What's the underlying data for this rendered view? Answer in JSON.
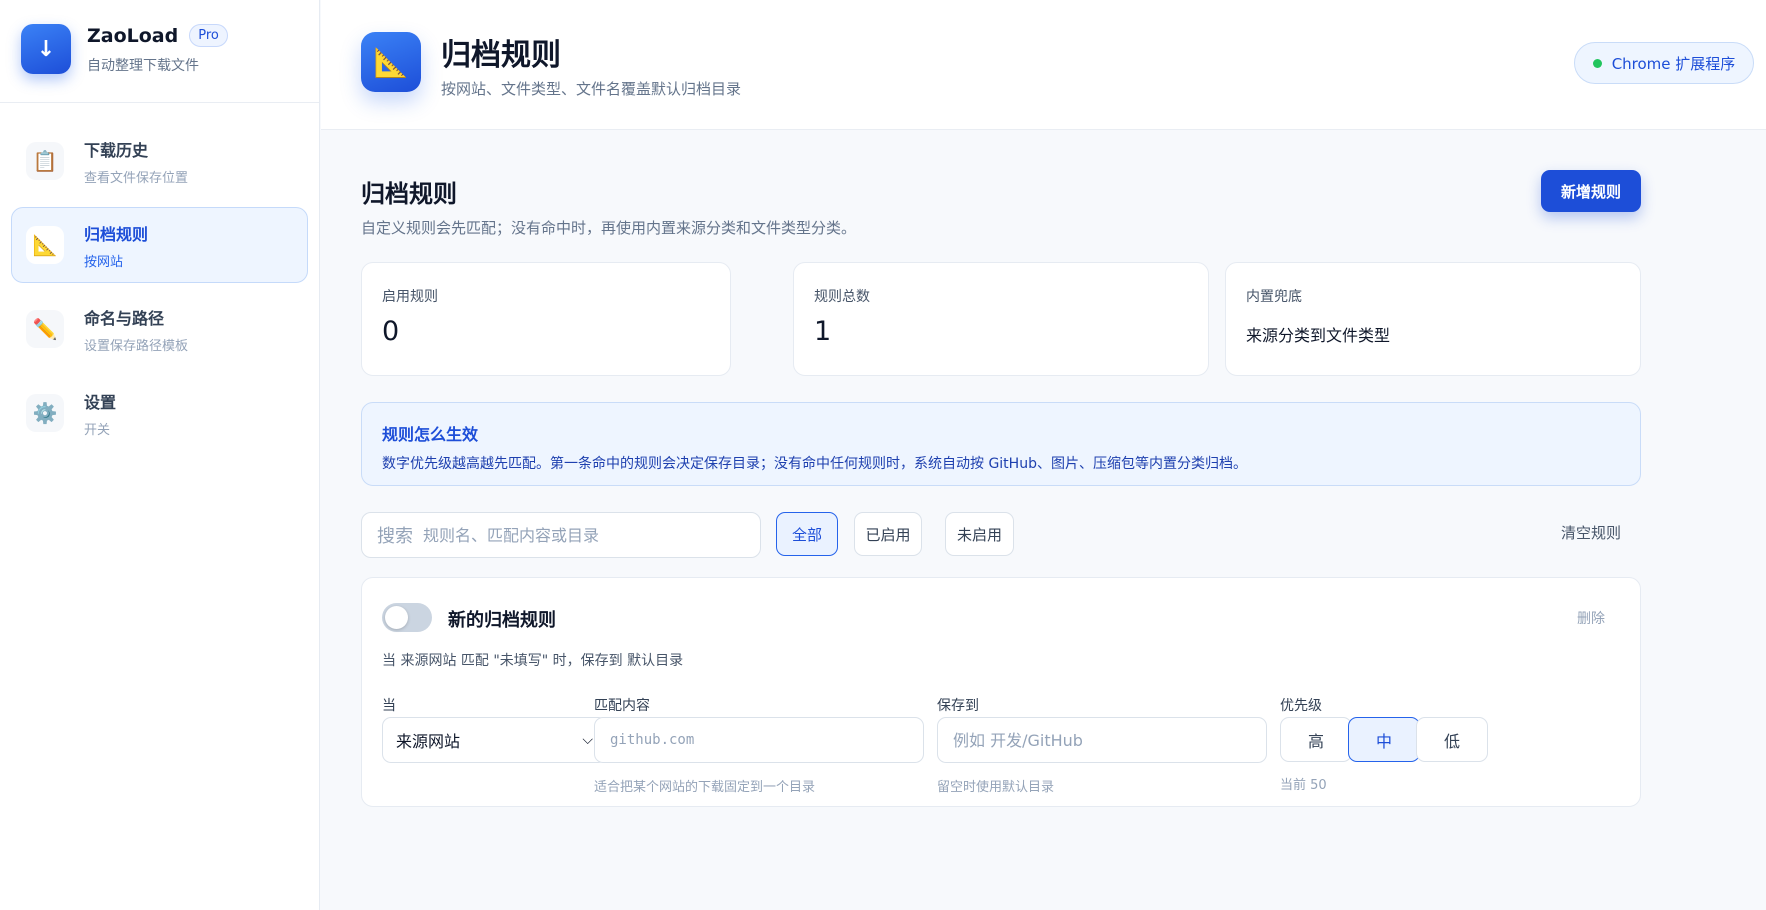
{
  "brand": {
    "logo_glyph": "↓",
    "name": "ZaoLoad",
    "badge": "Pro",
    "tagline": "自动整理下载文件"
  },
  "sidebar": {
    "items": [
      {
        "icon": "clipboard-icon",
        "glyph": "📋",
        "title": "下载历史",
        "subtitle": "查看文件保存位置",
        "active": false
      },
      {
        "icon": "triangle-ruler-icon",
        "glyph": "📐",
        "title": "归档规则",
        "subtitle": "按网站",
        "active": true
      },
      {
        "icon": "pencil-icon",
        "glyph": "✏️",
        "title": "命名与路径",
        "subtitle": "设置保存路径模板",
        "active": false
      },
      {
        "icon": "gear-icon",
        "glyph": "⚙️",
        "title": "设置",
        "subtitle": "开关",
        "active": false
      }
    ]
  },
  "header": {
    "icon": "triangle-ruler-icon",
    "glyph": "📐",
    "title": "归档规则",
    "subtitle": "按网站、文件类型、文件名覆盖默认归档目录",
    "extension_label": "Chrome 扩展程序"
  },
  "main": {
    "title": "归档规则",
    "description": "自定义规则会先匹配；没有命中时，再使用内置来源分类和文件类型分类。",
    "add_button": "新增规则",
    "stats": [
      {
        "label": "启用规则",
        "value": "0"
      },
      {
        "label": "规则总数",
        "value": "1"
      },
      {
        "label": "内置兜底",
        "value": "来源分类到文件类型"
      }
    ],
    "info": {
      "title": "规则怎么生效",
      "text": "数字优先级越高越先匹配。第一条命中的规则会决定保存目录；没有命中任何规则时，系统自动按 GitHub、图片、压缩包等内置分类归档。"
    },
    "search": {
      "label": "搜索",
      "placeholder": "规则名、匹配内容或目录",
      "value": ""
    },
    "filters": [
      {
        "label": "全部",
        "active": true
      },
      {
        "label": "已启用",
        "active": false
      },
      {
        "label": "未启用",
        "active": false
      }
    ],
    "clear_button": "清空规则",
    "rule": {
      "enabled": false,
      "name": "新的归档规则",
      "delete_label": "删除",
      "summary": "当 来源网站 匹配 \"未填写\" 时，保存到 默认目录",
      "when_label": "当",
      "when_value": "来源网站",
      "match_label": "匹配内容",
      "match_placeholder": "github.com",
      "match_hint": "适合把某个网站的下载固定到一个目录",
      "save_label": "保存到",
      "save_placeholder": "例如 开发/GitHub",
      "save_hint": "留空时使用默认目录",
      "priority_label": "优先级",
      "priority_options": [
        {
          "label": "高",
          "active": false
        },
        {
          "label": "中",
          "active": true
        },
        {
          "label": "低",
          "active": false
        }
      ],
      "priority_current": "当前 50"
    }
  },
  "colors": {
    "accent": "#1d4ed8",
    "accent_light": "#eef5ff",
    "status_green": "#22c55e"
  }
}
